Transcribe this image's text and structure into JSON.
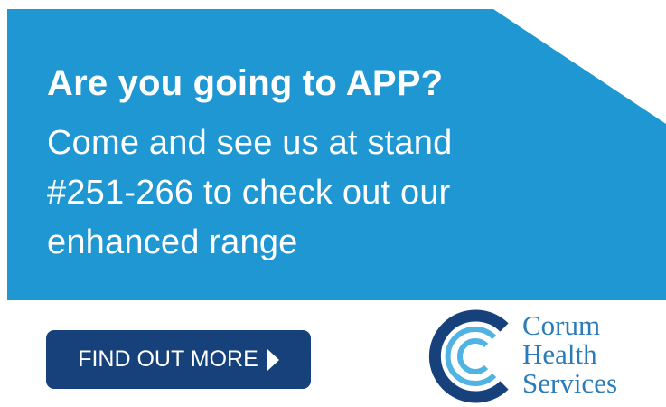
{
  "hero": {
    "headline": "Are you going to APP?",
    "lines": [
      "Come and see us at stand",
      "#251-266 to check out our",
      "enhanced range"
    ]
  },
  "cta": {
    "label": "FIND OUT MORE",
    "icon": "play-arrow-icon"
  },
  "logo": {
    "line1": "Corum",
    "line2": "Health",
    "line3": "Services",
    "icon": "corum-c-logo-icon"
  },
  "colors": {
    "banner": "#1e97d2",
    "banner_shadow": "#177fb3",
    "button": "#17417a",
    "logo_dark": "#17417a",
    "logo_light": "#4fb3e3",
    "logo_text": "#2a7bb8"
  }
}
